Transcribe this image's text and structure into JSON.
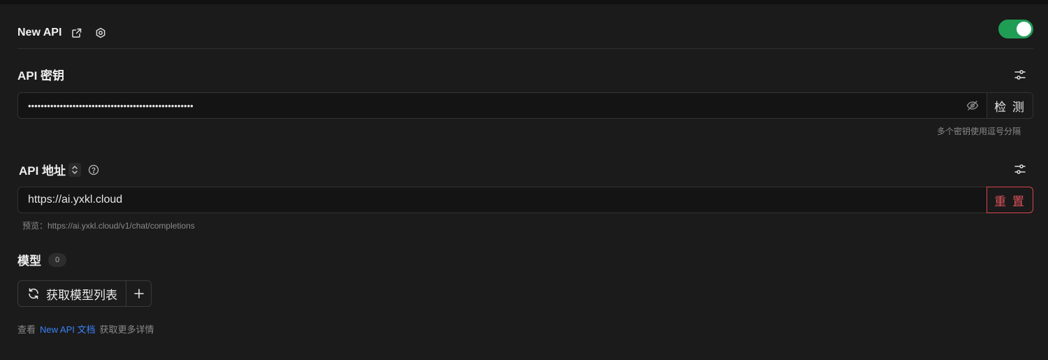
{
  "provider": {
    "name": "New API",
    "enabled": true,
    "external_link_icon": "external-link-icon",
    "settings_icon": "hexagon-settings-icon"
  },
  "api_key": {
    "title": "API 密钥",
    "value": "••••••••••••••••••••••••••••••••••••••••••••••••••••",
    "check_label": "检 测",
    "hint": "多个密钥使用逗号分隔"
  },
  "api_url": {
    "title": "API 地址",
    "value": "https://ai.yxkl.cloud",
    "reset_label": "重 置",
    "preview": "预览：https://ai.yxkl.cloud/v1/chat/completions"
  },
  "models": {
    "title": "模型",
    "count": "0",
    "fetch_label": "获取模型列表"
  },
  "footer": {
    "prefix": "查看",
    "link": "New API 文档",
    "suffix": "获取更多详情"
  },
  "colors": {
    "accent_green": "#1f9d55",
    "danger_red": "#e0525a",
    "link_blue": "#3b82f6"
  }
}
